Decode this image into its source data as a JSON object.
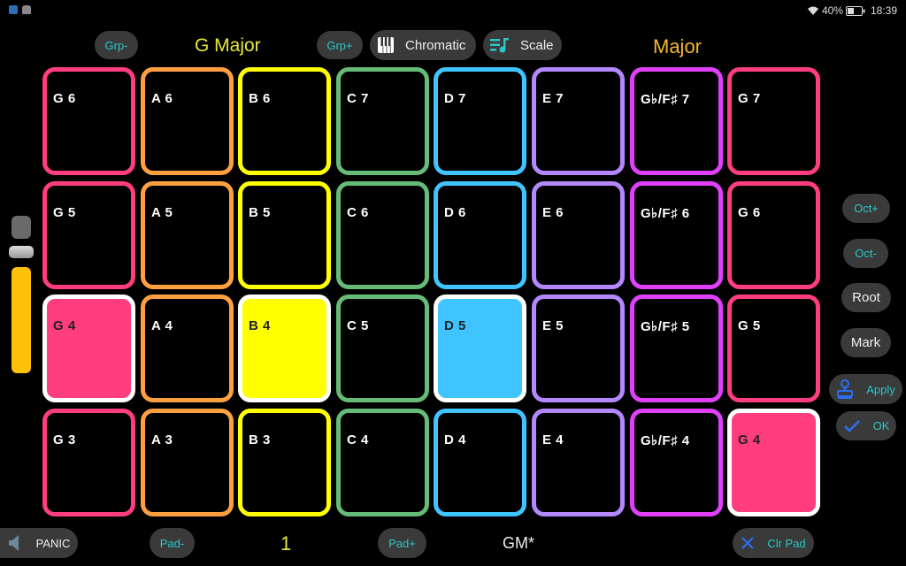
{
  "status_bar": {
    "left_icons": [
      "shield-app-icon",
      "robot-app-icon"
    ],
    "battery_percent": "40%",
    "time": "18:39"
  },
  "header": {
    "grp_minus": "Grp-",
    "key_title": "G Major",
    "grp_plus": "Grp+",
    "chromatic_label": "Chromatic",
    "scale_label": "Scale",
    "scale_name": "Major"
  },
  "colors": {
    "G": "#ff3d7f",
    "A": "#ffa040",
    "B": "#ffff00",
    "C": "#66bb77",
    "D": "#40c4ff",
    "E": "#b388ff",
    "Gb": "#e040fb",
    "title_yellow": "#e8e83a",
    "title_orange": "#f5b82e",
    "accent_cyan": "#29c7c7"
  },
  "pads": [
    [
      {
        "label": "G 6",
        "color": "G",
        "active": false
      },
      {
        "label": "A 6",
        "color": "A",
        "active": false
      },
      {
        "label": "B 6",
        "color": "B",
        "active": false
      },
      {
        "label": "C 7",
        "color": "C",
        "active": false
      },
      {
        "label": "D 7",
        "color": "D",
        "active": false
      },
      {
        "label": "E 7",
        "color": "E",
        "active": false
      },
      {
        "label": "G♭/F♯ 7",
        "color": "Gb",
        "active": false
      },
      {
        "label": "G 7",
        "color": "G",
        "active": false
      }
    ],
    [
      {
        "label": "G 5",
        "color": "G",
        "active": false
      },
      {
        "label": "A 5",
        "color": "A",
        "active": false
      },
      {
        "label": "B 5",
        "color": "B",
        "active": false
      },
      {
        "label": "C 6",
        "color": "C",
        "active": false
      },
      {
        "label": "D 6",
        "color": "D",
        "active": false
      },
      {
        "label": "E 6",
        "color": "E",
        "active": false
      },
      {
        "label": "G♭/F♯ 6",
        "color": "Gb",
        "active": false
      },
      {
        "label": "G 6",
        "color": "G",
        "active": false
      }
    ],
    [
      {
        "label": "G 4",
        "color": "G",
        "active": true
      },
      {
        "label": "A 4",
        "color": "A",
        "active": false
      },
      {
        "label": "B 4",
        "color": "B",
        "active": true
      },
      {
        "label": "C 5",
        "color": "C",
        "active": false
      },
      {
        "label": "D 5",
        "color": "D",
        "active": true
      },
      {
        "label": "E 5",
        "color": "E",
        "active": false
      },
      {
        "label": "G♭/F♯ 5",
        "color": "Gb",
        "active": false
      },
      {
        "label": "G 5",
        "color": "G",
        "active": false
      }
    ],
    [
      {
        "label": "G 3",
        "color": "G",
        "active": false
      },
      {
        "label": "A 3",
        "color": "A",
        "active": false
      },
      {
        "label": "B 3",
        "color": "B",
        "active": false
      },
      {
        "label": "C 4",
        "color": "C",
        "active": false
      },
      {
        "label": "D 4",
        "color": "D",
        "active": false
      },
      {
        "label": "E 4",
        "color": "E",
        "active": false
      },
      {
        "label": "G♭/F♯ 4",
        "color": "Gb",
        "active": false
      },
      {
        "label": "G 4",
        "color": "G",
        "active": true
      }
    ]
  ],
  "velocity_slider": {
    "value_fraction": 0.68
  },
  "side_buttons": {
    "oct_plus": "Oct+",
    "oct_minus": "Oct-",
    "root": "Root",
    "mark": "Mark",
    "apply": "Apply",
    "ok": "OK"
  },
  "footer": {
    "panic": "PANIC",
    "pad_minus": "Pad-",
    "pad_number": "1",
    "pad_plus": "Pad+",
    "preset_name": "GM*",
    "clear_pad": "Clr Pad"
  }
}
